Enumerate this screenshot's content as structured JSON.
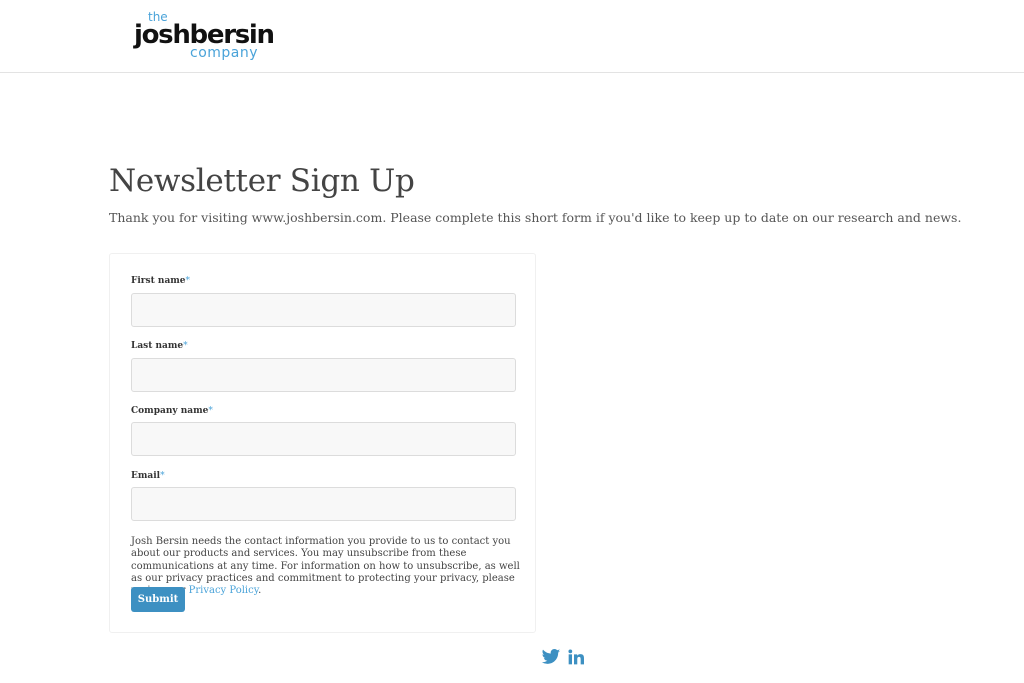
{
  "brand": {
    "the": "the",
    "name": "joshbersin",
    "company": "company"
  },
  "page": {
    "title": "Newsletter Sign Up",
    "intro": "Thank you for visiting www.joshbersin.com. Please complete this short form if you'd like to keep up to date on our research and news."
  },
  "form": {
    "required_mark": "*",
    "fields": [
      {
        "label": "First name",
        "value": "",
        "placeholder": ""
      },
      {
        "label": "Last name",
        "value": "",
        "placeholder": ""
      },
      {
        "label": "Company name",
        "value": "",
        "placeholder": ""
      },
      {
        "label": "Email",
        "value": "",
        "placeholder": ""
      }
    ],
    "legal_text": "Josh Bersin needs the contact information you provide to us to contact you about our products and services. You may unsubscribe from these communications at any time. For information on how to unsubscribe, as well as our privacy practices and commitment to protecting your privacy, please review our",
    "privacy_link": "Privacy Policy",
    "legal_end": ".",
    "submit_label": "Submit"
  },
  "social": {
    "icons": [
      "twitter-icon",
      "linkedin-icon"
    ]
  },
  "colors": {
    "accent": "#4aa3d9",
    "button": "#3d90c2",
    "text": "#444444"
  }
}
